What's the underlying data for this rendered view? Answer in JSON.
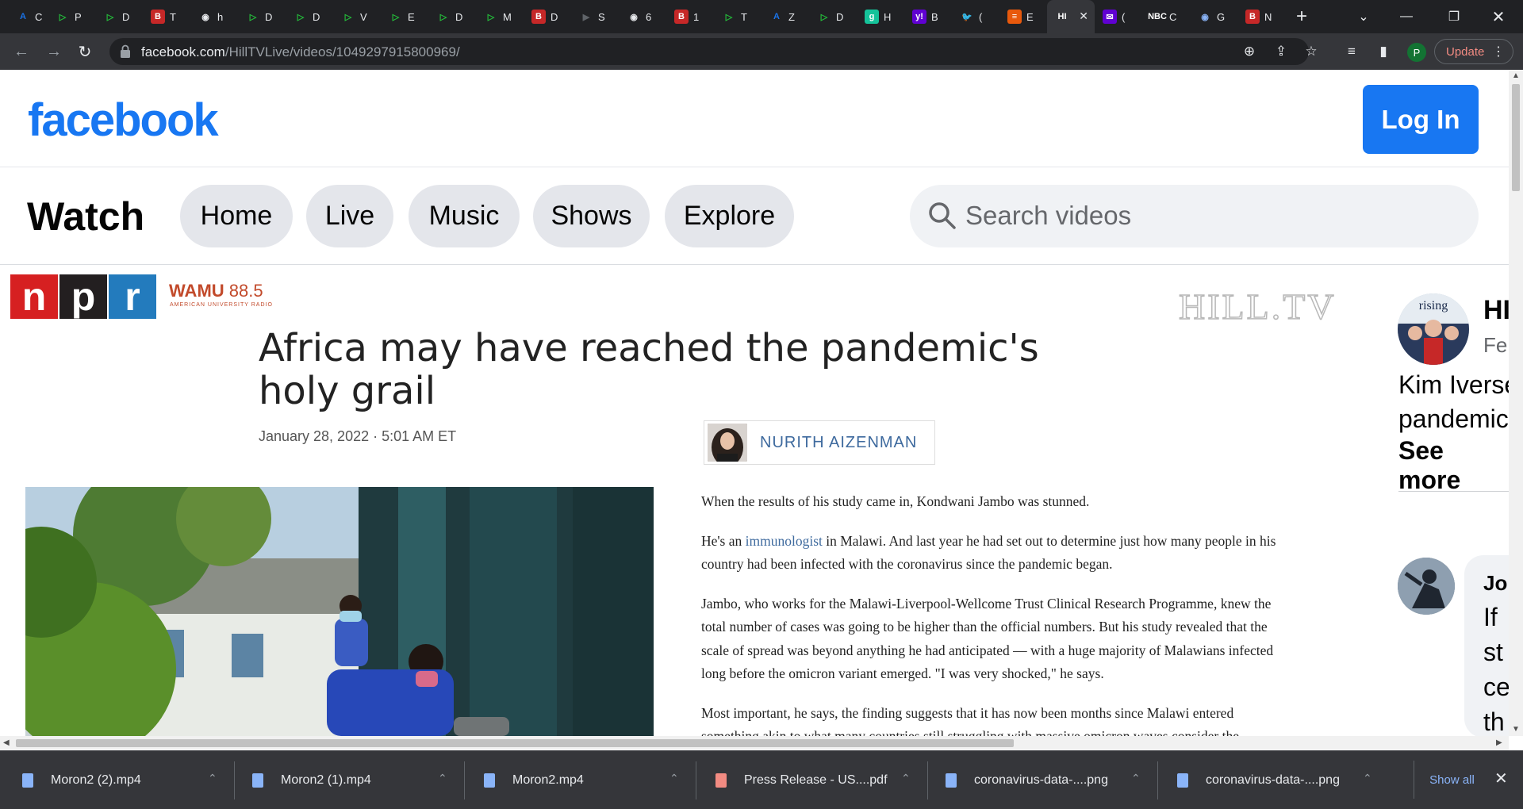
{
  "browser": {
    "tabs": [
      {
        "glyph": "A",
        "color": "#1a73e8",
        "bg": "transparent",
        "label": "C"
      },
      {
        "glyph": "▷",
        "color": "#24c33b",
        "bg": "transparent",
        "label": "P"
      },
      {
        "glyph": "▷",
        "color": "#24c33b",
        "bg": "transparent",
        "label": "D"
      },
      {
        "glyph": "B",
        "color": "#fff",
        "bg": "#c62828",
        "label": "T"
      },
      {
        "glyph": "◉",
        "color": "#e8eaed",
        "bg": "transparent",
        "label": "h"
      },
      {
        "glyph": "▷",
        "color": "#24c33b",
        "bg": "transparent",
        "label": "D"
      },
      {
        "glyph": "▷",
        "color": "#24c33b",
        "bg": "transparent",
        "label": "D"
      },
      {
        "glyph": "▷",
        "color": "#24c33b",
        "bg": "transparent",
        "label": "V"
      },
      {
        "glyph": "▷",
        "color": "#24c33b",
        "bg": "transparent",
        "label": "E"
      },
      {
        "glyph": "▷",
        "color": "#24c33b",
        "bg": "transparent",
        "label": "D"
      },
      {
        "glyph": "▷",
        "color": "#24c33b",
        "bg": "transparent",
        "label": "M"
      },
      {
        "glyph": "B",
        "color": "#fff",
        "bg": "#c62828",
        "label": "D"
      },
      {
        "glyph": "▶",
        "color": "#5f6368",
        "bg": "transparent",
        "label": "S"
      },
      {
        "glyph": "◉",
        "color": "#e8eaed",
        "bg": "transparent",
        "label": "6"
      },
      {
        "glyph": "B",
        "color": "#fff",
        "bg": "#c62828",
        "label": "1"
      },
      {
        "glyph": "▷",
        "color": "#24c33b",
        "bg": "transparent",
        "label": "T"
      },
      {
        "glyph": "A",
        "color": "#1a73e8",
        "bg": "transparent",
        "label": "Z"
      },
      {
        "glyph": "▷",
        "color": "#24c33b",
        "bg": "transparent",
        "label": "D"
      },
      {
        "glyph": "g",
        "color": "#fff",
        "bg": "#15c39a",
        "label": "H"
      },
      {
        "glyph": "y!",
        "color": "#fff",
        "bg": "#6001d2",
        "label": "B"
      },
      {
        "glyph": "🐦",
        "color": "#1d9bf0",
        "bg": "transparent",
        "label": "("
      },
      {
        "glyph": "≡",
        "color": "#fff",
        "bg": "#e8590c",
        "label": "E"
      },
      {
        "glyph": "HI",
        "color": "#fff",
        "bg": "transparent",
        "label": "",
        "active": true
      },
      {
        "glyph": "✉",
        "color": "#fff",
        "bg": "#6001d2",
        "label": "("
      },
      {
        "glyph": "NBC",
        "color": "#fff",
        "bg": "transparent",
        "label": "C"
      },
      {
        "glyph": "◉",
        "color": "#8ab4f8",
        "bg": "transparent",
        "label": "G"
      },
      {
        "glyph": "B",
        "color": "#fff",
        "bg": "#c62828",
        "label": "N"
      }
    ],
    "new_tab": "+",
    "url_host": "facebook.com",
    "url_path": "/HillTVLive/videos/1049297915800969/",
    "profile_initial": "P",
    "update_label": "Update"
  },
  "facebook": {
    "logo": "facebook",
    "login_label": "Log In",
    "watch_title": "Watch",
    "nav": [
      "Home",
      "Live",
      "Music",
      "Shows",
      "Explore"
    ],
    "search_placeholder": "Search videos"
  },
  "video": {
    "npr_letters": [
      "n",
      "p",
      "r"
    ],
    "npr_colors": [
      "#d62021",
      "#231f20",
      "#237bbd"
    ],
    "wamu_name": "WAMU",
    "wamu_freq": "88.5",
    "wamu_sub": "AMERICAN UNIVERSITY RADIO",
    "watermark": "HILL.TV",
    "headline": "Africa may have reached the pandemic's holy grail",
    "dateline": "January 28, 2022 · 5:01 AM ET",
    "author": "NURITH AIZENMAN",
    "paragraphs": {
      "p1": "When the results of his study came in, Kondwani Jambo was stunned.",
      "p2_a": "He's an ",
      "p2_link": "immunologist",
      "p2_b": " in Malawi. And last year he had set out to determine just how many people in his country had been infected with the coronavirus since the pandemic began.",
      "p3": "Jambo, who works for the Malawi-Liverpool-Wellcome Trust Clinical Research Programme, knew the total number of cases was going to be higher than the official numbers. But his study revealed that the scale of spread was beyond anything he had anticipated — with a huge majority of Malawians infected long before the omicron variant emerged. \"I was very shocked,\" he says.",
      "p4": "Most important, he says, the finding suggests that it has now been months since Malawi entered something akin to what many countries still struggling with massive omicron waves consider the"
    }
  },
  "side": {
    "avatar_label": "rising",
    "name": "HI",
    "sub": "Fe",
    "text_line1": "Kim Iverse",
    "text_line2": "pandemic",
    "see_more": "See more",
    "comment_author": "Jo",
    "comment_text": "If\nst\nce\nth"
  },
  "downloads": {
    "items": [
      {
        "name": "Moron2 (2).mp4",
        "type": "doc"
      },
      {
        "name": "Moron2 (1).mp4",
        "type": "doc"
      },
      {
        "name": "Moron2.mp4",
        "type": "doc"
      },
      {
        "name": "Press Release - US....pdf",
        "type": "pdf"
      },
      {
        "name": "coronavirus-data-....png",
        "type": "doc"
      },
      {
        "name": "coronavirus-data-....png",
        "type": "doc"
      }
    ],
    "show_all": "Show all"
  }
}
